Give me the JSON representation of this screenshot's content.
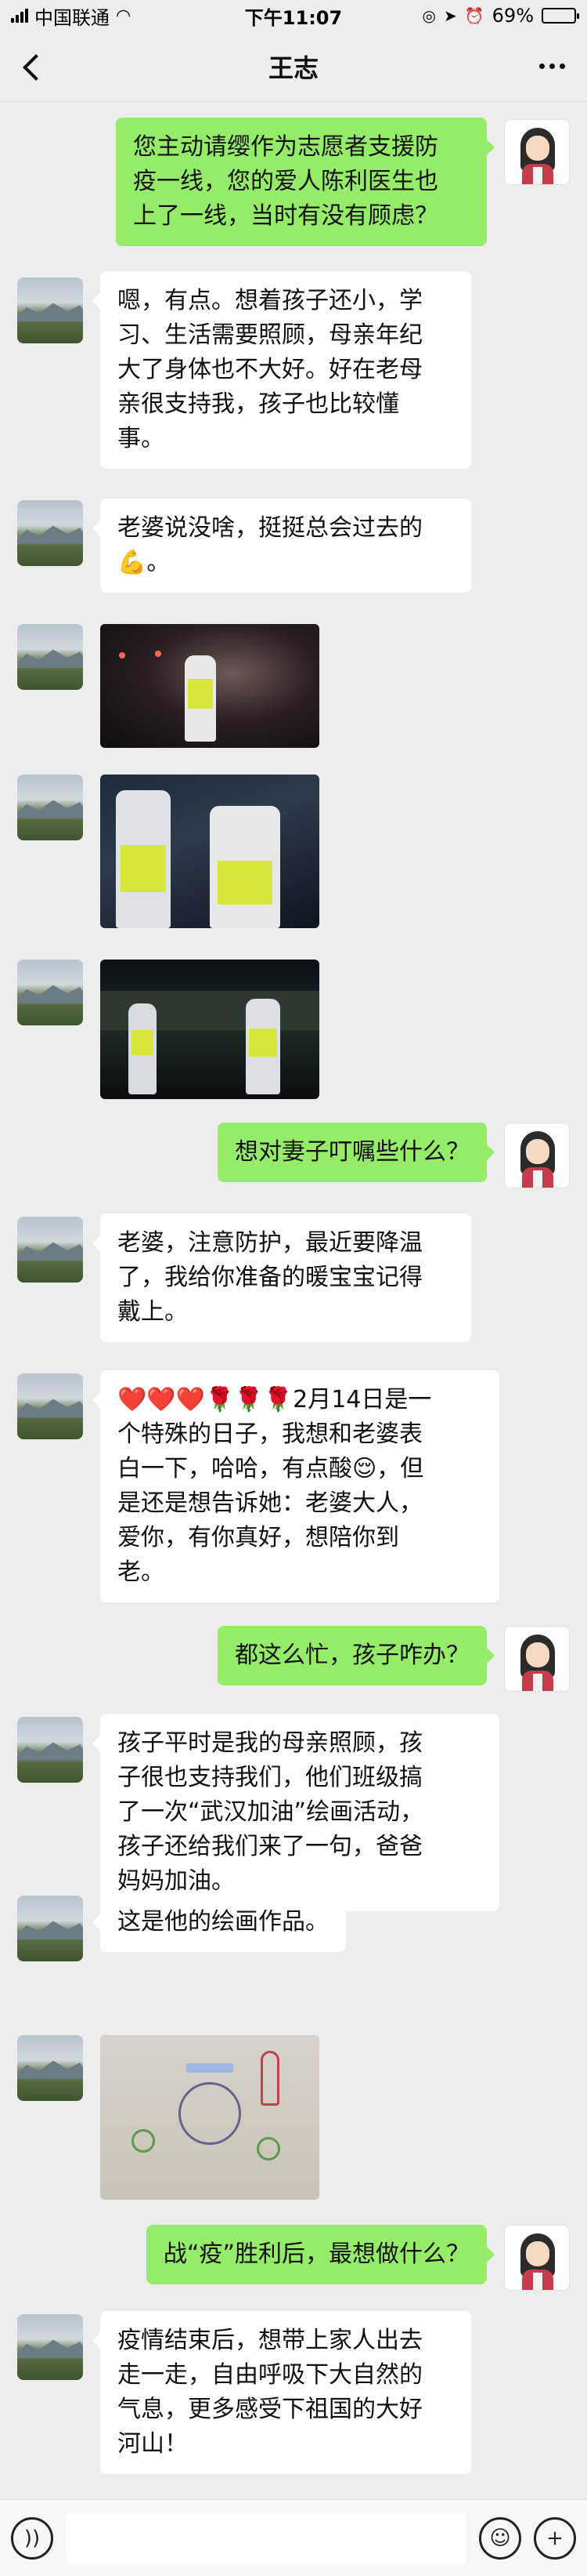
{
  "status_bar": {
    "carrier": "中国联通",
    "time": "下午11:07",
    "battery": "69%",
    "battery_level": 0.69
  },
  "header": {
    "title": "王志"
  },
  "messages": [
    {
      "side": "out",
      "text": "您主动请缨作为志愿者支援防\n疫一线，您的爱人陈利医生也\n上了一线，当时有没有顾虑？"
    },
    {
      "side": "in",
      "text": "嗯，有点。想着孩子还小，学\n习、生活需要照顾，母亲年纪\n大了身体也不大好。好在老母\n亲很支持我，孩子也比较懂\n事。"
    },
    {
      "side": "in",
      "text": "老婆说没啥，挺挺总会过去的\n💪。"
    },
    {
      "side": "out",
      "text": "想对妻子叮嘱些什么？"
    },
    {
      "side": "in",
      "text": "老婆，注意防护，最近要降温\n了，我给你准备的暖宝宝记得\n戴上。"
    },
    {
      "side": "in",
      "text": "❤️❤️❤️🌹🌹🌹2月14日是一\n个特殊的日子，我想和老婆表\n白一下，哈哈，有点酸😌，但\n是还是想告诉她：老婆大人，\n爱你，有你真好，想陪你到\n老。"
    },
    {
      "side": "out",
      "text": "都这么忙，孩子咋办？"
    },
    {
      "side": "in",
      "text": "孩子平时是我的母亲照顾，孩\n子很也支持我们，他们班级搞\n了一次“武汉加油”绘画活动，\n孩子还给我们来了一句，爸爸\n妈妈加油。"
    },
    {
      "side": "in",
      "text": "这是他的绘画作品。"
    },
    {
      "side": "out",
      "text": "战“疫”胜利后，最想做什么？"
    },
    {
      "side": "in",
      "text": "疫情结束后，想带上家人出去\n走一走，自由呼吸下大自然的\n气息，更多感受下祖国的大好\n河山！"
    }
  ]
}
